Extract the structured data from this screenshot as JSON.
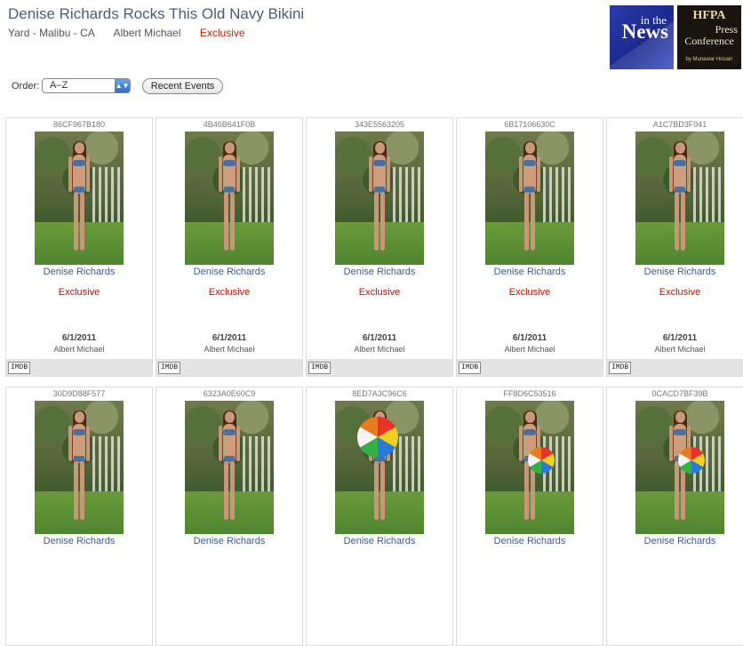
{
  "header": {
    "title": "Denise Richards Rocks This Old Navy Bikini",
    "location": "Yard - Malibu - CA",
    "photographer": "Albert Michael",
    "tag": "Exclusive"
  },
  "logos": {
    "news_line1": "in the",
    "news_line2": "News",
    "hfpa_line1": "HFPA",
    "hfpa_line2": "Press",
    "hfpa_line3": "Conference",
    "hfpa_byline": "by Munawar Hosain"
  },
  "controls": {
    "order_label": "Order:",
    "order_value": "A–Z",
    "recent_events_label": "Recent Events"
  },
  "cards": [
    {
      "code": "86CF967B180",
      "name": "Denise Richards",
      "exclusive": "Exclusive",
      "date": "6/1/2011",
      "photographer": "Albert Michael",
      "imdb": "IMDB"
    },
    {
      "code": "4B46B641F0B",
      "name": "Denise Richards",
      "exclusive": "Exclusive",
      "date": "6/1/2011",
      "photographer": "Albert Michael",
      "imdb": "IMDB"
    },
    {
      "code": "343E5563205",
      "name": "Denise Richards",
      "exclusive": "Exclusive",
      "date": "6/1/2011",
      "photographer": "Albert Michael",
      "imdb": "IMDB"
    },
    {
      "code": "6B17106630C",
      "name": "Denise Richards",
      "exclusive": "Exclusive",
      "date": "6/1/2011",
      "photographer": "Albert Michael",
      "imdb": "IMDB"
    },
    {
      "code": "A1C7BD3F941",
      "name": "Denise Richards",
      "exclusive": "Exclusive",
      "date": "6/1/2011",
      "photographer": "Albert Michael",
      "imdb": "IMDB"
    },
    {
      "code": "30D9D88F577",
      "name": "Denise Richards"
    },
    {
      "code": "6323A0E60C9",
      "name": "Denise Richards"
    },
    {
      "code": "8ED7A3C96C6",
      "name": "Denise Richards"
    },
    {
      "code": "FF8D6C53516",
      "name": "Denise Richards"
    },
    {
      "code": "0CACD7BF39B",
      "name": "Denise Richards"
    }
  ],
  "colors": {
    "title": "#4a5c78",
    "link": "#3a5a9a",
    "exclusive": "#bb1100"
  }
}
